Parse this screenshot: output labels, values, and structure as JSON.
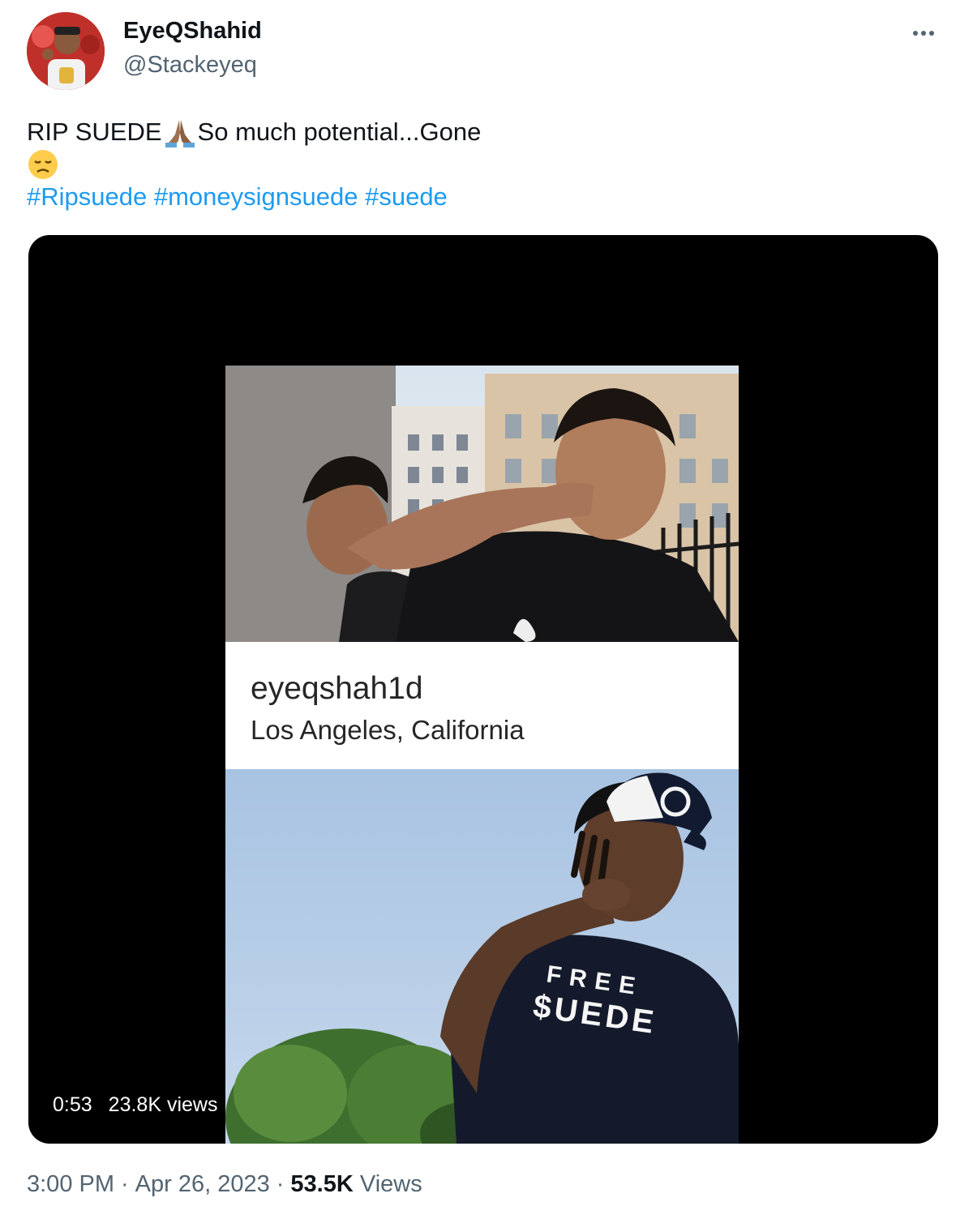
{
  "author": {
    "name": "EyeQShahid",
    "handle": "@Stackeyeq",
    "avatar_icon": "profile-avatar"
  },
  "tweet": {
    "text_line1_a": "RIP SUEDE",
    "text_line1_b": "So much potential...Gone",
    "emoji_1": "folded-hands",
    "emoji_2": "disappointed-face",
    "hashtags": [
      "#Ripsuede",
      "#moneysignsuede",
      "#suede"
    ]
  },
  "video": {
    "duration": "0:53",
    "views": "23.8K views",
    "embedded_card": {
      "username": "eyeqshah1d",
      "location": "Los Angeles, California"
    },
    "shirt_text_line1": "FREE",
    "shirt_text_line2": "$UEDE"
  },
  "footer": {
    "time": "3:00 PM",
    "date": "Apr 26, 2023",
    "views_count": "53.5K",
    "views_label": "Views"
  },
  "colors": {
    "link": "#1d9bf0",
    "secondary_text": "#536471",
    "primary_text": "#0f1419"
  }
}
